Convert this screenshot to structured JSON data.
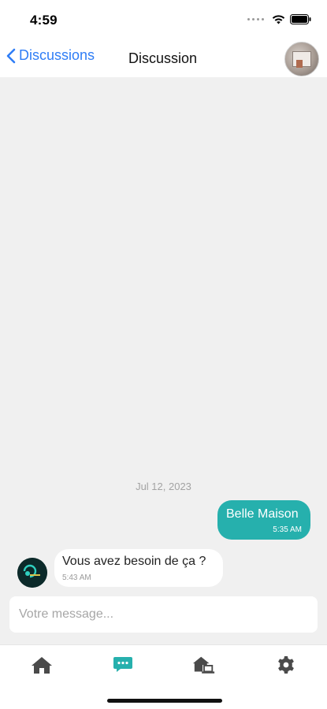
{
  "status_bar": {
    "time": "4:59"
  },
  "nav": {
    "back_label": "Discussions",
    "title": "Discussion"
  },
  "chat": {
    "date_separator": "Jul 12, 2023",
    "messages": [
      {
        "direction": "outgoing",
        "text": "Belle Maison",
        "time": "5:35 AM"
      },
      {
        "direction": "incoming",
        "text": "Vous avez besoin de ça ?",
        "time": "5:43 AM"
      }
    ]
  },
  "composer": {
    "placeholder": "Votre message..."
  },
  "tabs": [
    {
      "icon": "home-icon",
      "active": false
    },
    {
      "icon": "chat-bubble-icon",
      "active": true
    },
    {
      "icon": "house-laptop-icon",
      "active": false
    },
    {
      "icon": "gear-icon",
      "active": false
    }
  ],
  "colors": {
    "accent": "#26b0ad",
    "link": "#2f7df6",
    "chat_background": "#f0f0f0",
    "tab_inactive": "#4a4a4a"
  }
}
